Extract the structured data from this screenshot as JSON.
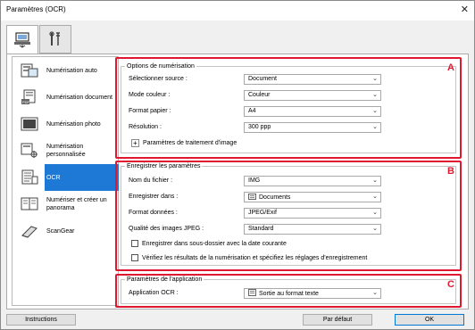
{
  "window": {
    "title": "Paramètres (OCR)"
  },
  "tabs": [
    {
      "icon": "scan-from-computer-icon"
    },
    {
      "icon": "tools-icon"
    }
  ],
  "sidebar": {
    "items": [
      {
        "label": "Numérisation auto",
        "icon": "auto-scan-icon"
      },
      {
        "label": "Numérisation document",
        "icon": "document-scan-icon"
      },
      {
        "label": "Numérisation photo",
        "icon": "photo-scan-icon"
      },
      {
        "label": "Numérisation personnalisée",
        "icon": "custom-scan-icon"
      },
      {
        "label": "OCR",
        "icon": "ocr-icon",
        "selected": true
      },
      {
        "label": "Numériser et créer un panorama",
        "icon": "panorama-icon"
      },
      {
        "label": "ScanGear",
        "icon": "scangear-icon"
      }
    ]
  },
  "scan_options": {
    "title": "Options de numérisation",
    "letter": "A",
    "select_source_label": "Sélectionner source :",
    "select_source_value": "Document",
    "color_mode_label": "Mode couleur :",
    "color_mode_value": "Couleur",
    "paper_size_label": "Format papier :",
    "paper_size_value": "A4",
    "resolution_label": "Résolution :",
    "resolution_value": "300 ppp",
    "image_processing_label": "Paramètres de traitement d'image"
  },
  "save_settings": {
    "title": "Enregistrer les paramètres",
    "letter": "B",
    "file_name_label": "Nom du fichier :",
    "file_name_value": "IMG",
    "save_in_label": "Enregistrer dans :",
    "save_in_value": "Documents",
    "data_format_label": "Format données :",
    "data_format_value": "JPEG/Exif",
    "jpeg_quality_label": "Qualité des images JPEG :",
    "jpeg_quality_value": "Standard",
    "subfolder_checkbox_label": "Enregistrer dans sous-dossier avec la date courante",
    "subfolder_checked": false,
    "verify_checkbox_label": "Vérifiez les résultats de la numérisation et spécifiez les réglages d'enregistrement",
    "verify_checked": false
  },
  "app_settings": {
    "title": "Paramètres de l'application",
    "letter": "C",
    "ocr_app_label": "Application OCR :",
    "ocr_app_value": "Sortie au format texte"
  },
  "footer": {
    "instructions_label": "Instructions",
    "defaults_label": "Par défaut",
    "ok_label": "OK"
  },
  "colors": {
    "highlight_border": "#e0182f",
    "selection": "#1e79d6"
  }
}
